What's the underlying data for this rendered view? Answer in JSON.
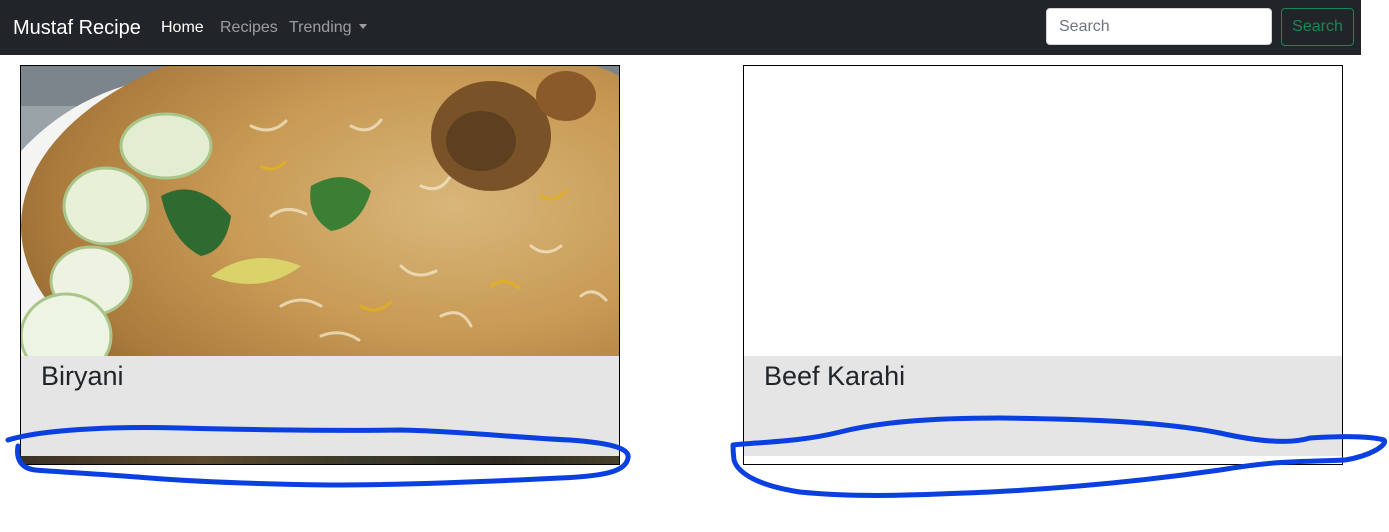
{
  "navbar": {
    "brand": "Mustaf Recipe",
    "links": [
      {
        "label": "Home",
        "active": true
      },
      {
        "label": "Recipes",
        "active": false
      },
      {
        "label": "Trending",
        "active": false,
        "dropdown": true
      }
    ],
    "search": {
      "placeholder": "Search",
      "button_label": "Search"
    }
  },
  "cards": [
    {
      "title": "Biryani",
      "image": "biryani-photo"
    },
    {
      "title": "Beef Karahi",
      "image": "image-not-loaded"
    }
  ],
  "annotations": {
    "color": "#0a3fe0",
    "shape": "hand-drawn-outline"
  },
  "colors": {
    "navbar_bg": "#212529",
    "search_button": "#198754",
    "card_body_bg": "#e5e5e5"
  }
}
